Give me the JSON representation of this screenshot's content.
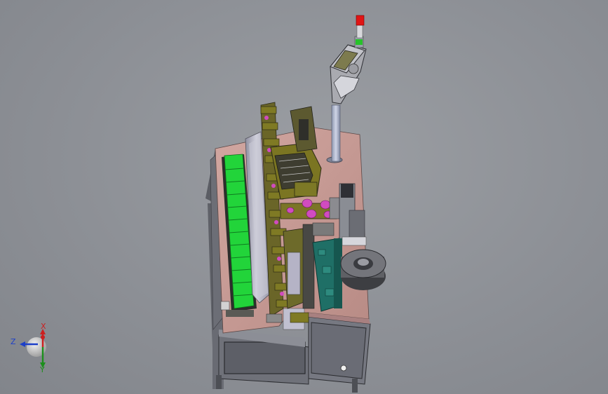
{
  "viewport": {
    "background_color": "#8e9196",
    "model": {
      "colors": {
        "table_top": "#c89c96",
        "frame": "#6e7078",
        "conveyor": "#22d43a",
        "mechanism_olive": "#7f7a24",
        "mechanism_dark": "#3e3d30",
        "cover_panel": "#b5b5c3",
        "plate_teal": "#1f6f66",
        "magenta_parts": "#d14bc0",
        "reel": "#5f6065",
        "tower_light_red": "#e01515",
        "tower_light_green": "#27c22a"
      }
    },
    "triad": {
      "x_label": "X",
      "y_label": "Y",
      "z_label": "Z",
      "x_color": "#cc1f1f",
      "y_color": "#1c8f1c",
      "z_color": "#1d3fc8"
    }
  }
}
